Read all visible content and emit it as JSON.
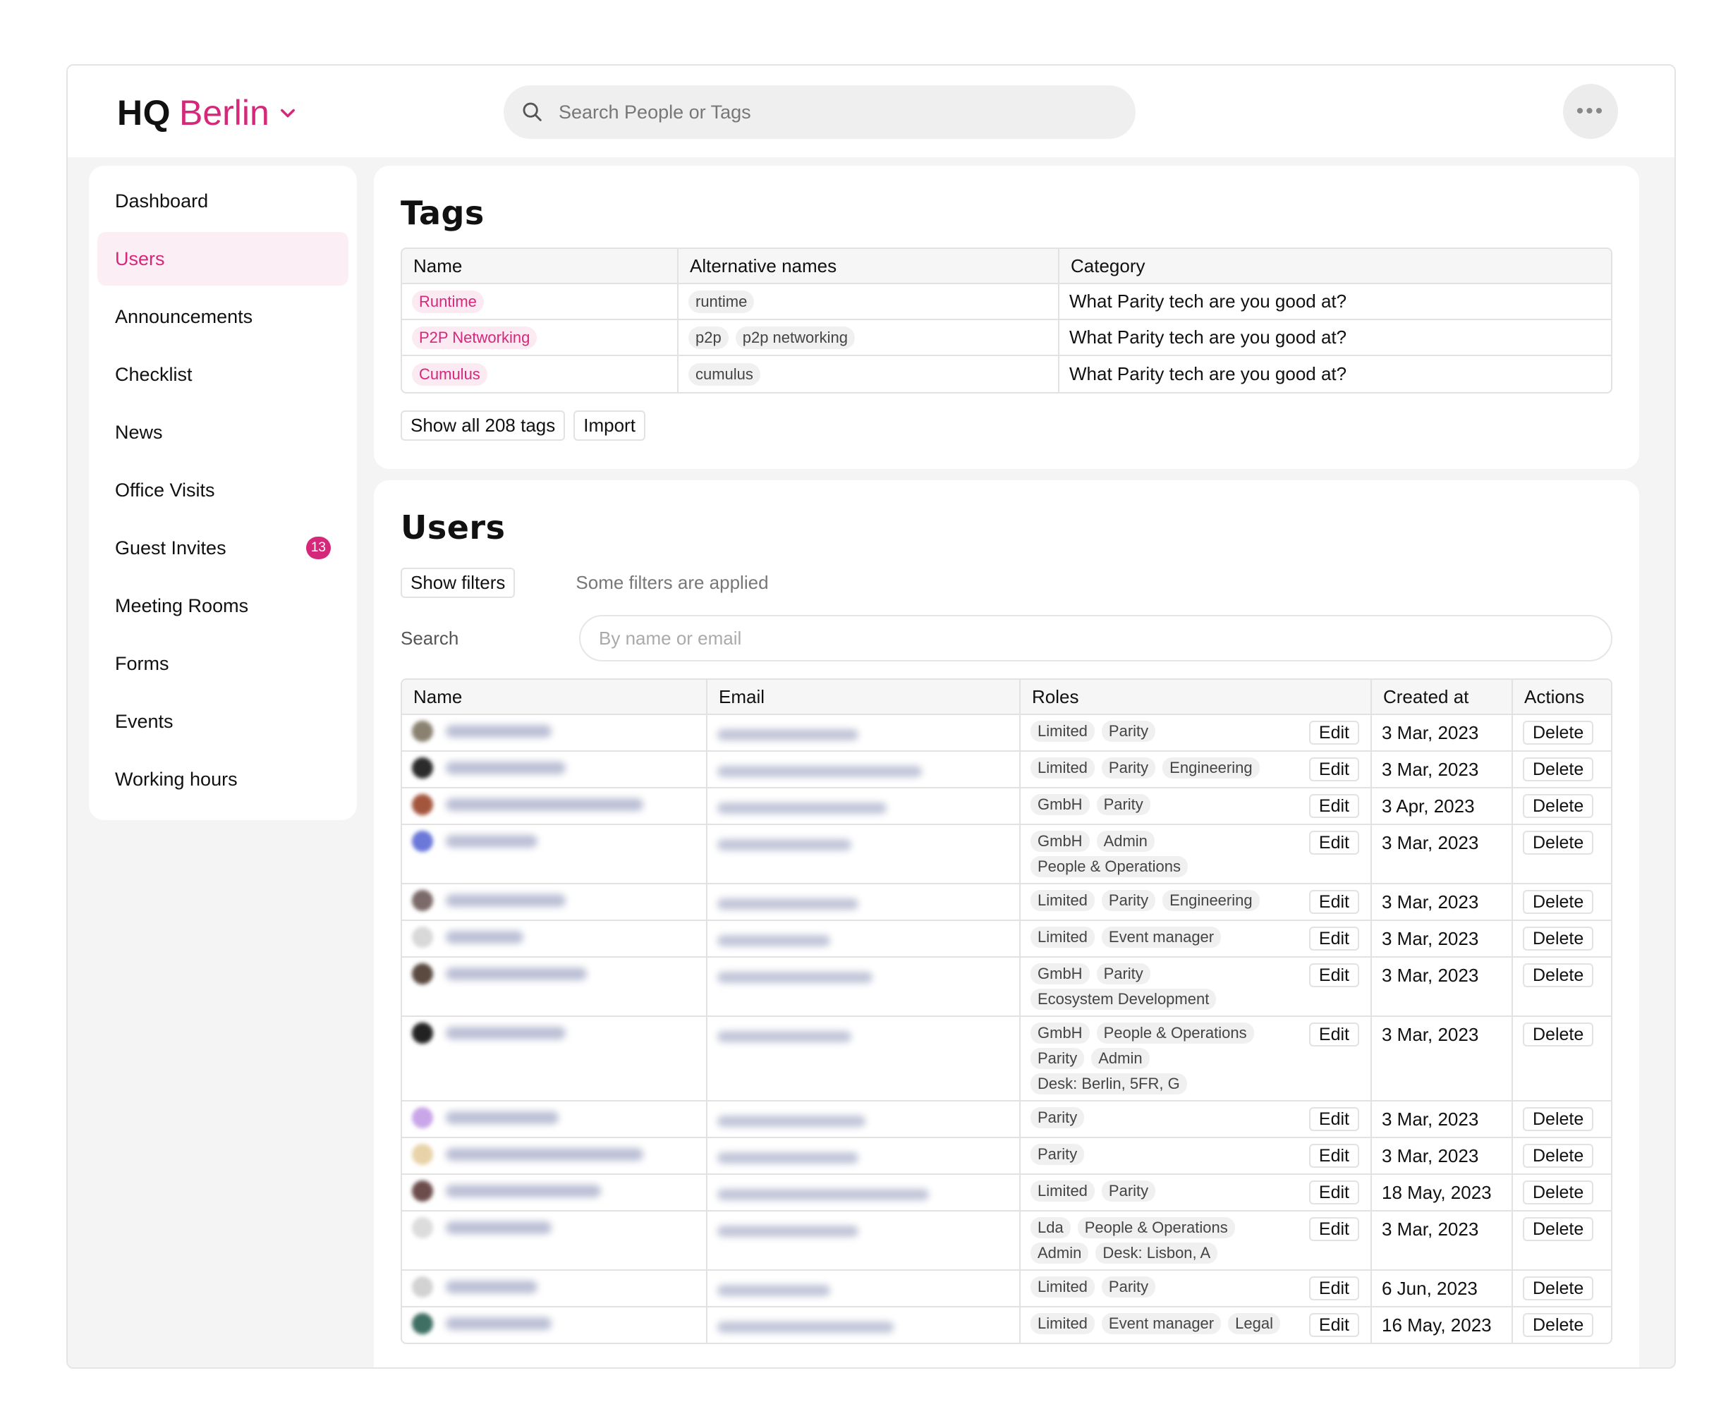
{
  "app": {
    "logo_hq": "HQ",
    "logo_city": "Berlin"
  },
  "search": {
    "placeholder": "Search People or Tags"
  },
  "sidebar": {
    "items": [
      {
        "label": "Dashboard",
        "name": "sidebar-item-dashboard"
      },
      {
        "label": "Users",
        "name": "sidebar-item-users",
        "active": true
      },
      {
        "label": "Announcements",
        "name": "sidebar-item-announcements"
      },
      {
        "label": "Checklist",
        "name": "sidebar-item-checklist"
      },
      {
        "label": "News",
        "name": "sidebar-item-news"
      },
      {
        "label": "Office Visits",
        "name": "sidebar-item-office-visits"
      },
      {
        "label": "Guest Invites",
        "name": "sidebar-item-guest-invites",
        "badge": "13"
      },
      {
        "label": "Meeting Rooms",
        "name": "sidebar-item-meeting-rooms"
      },
      {
        "label": "Forms",
        "name": "sidebar-item-forms"
      },
      {
        "label": "Events",
        "name": "sidebar-item-events"
      },
      {
        "label": "Working hours",
        "name": "sidebar-item-working-hours"
      }
    ]
  },
  "tags": {
    "title": "Tags",
    "headers": [
      "Name",
      "Alternative names",
      "Category"
    ],
    "rows": [
      {
        "name": "Runtime",
        "alts": [
          "runtime"
        ],
        "category": "What Parity tech are you good at?"
      },
      {
        "name": "P2P Networking",
        "alts": [
          "p2p",
          "p2p networking"
        ],
        "category": "What Parity tech are you good at?"
      },
      {
        "name": "Cumulus",
        "alts": [
          "cumulus"
        ],
        "category": "What Parity tech are you good at?"
      }
    ],
    "show_all_label": "Show all 208 tags",
    "import_label": "Import"
  },
  "users": {
    "title": "Users",
    "show_filters_label": "Show filters",
    "filter_note": "Some filters are applied",
    "search_label": "Search",
    "search_placeholder": "By name or email",
    "headers": [
      "Name",
      "Email",
      "Roles",
      "Created at",
      "Actions"
    ],
    "edit_label": "Edit",
    "delete_label": "Delete",
    "rows": [
      {
        "avatar_color": "#8a8170",
        "roles": [
          "Limited",
          "Parity"
        ],
        "created": "3 Mar, 2023"
      },
      {
        "avatar_color": "#2b2b2b",
        "roles": [
          "Limited",
          "Parity",
          "Engineering"
        ],
        "created": "3 Mar, 2023"
      },
      {
        "avatar_color": "#a4563d",
        "roles": [
          "GmbH",
          "Parity"
        ],
        "created": "3 Apr, 2023"
      },
      {
        "avatar_color": "#6b78d8",
        "roles": [
          "GmbH",
          "Admin",
          "People & Operations"
        ],
        "created": "3 Mar, 2023"
      },
      {
        "avatar_color": "#7a6a68",
        "roles": [
          "Limited",
          "Parity",
          "Engineering"
        ],
        "created": "3 Mar, 2023"
      },
      {
        "avatar_color": "#d8d8d8",
        "roles": [
          "Limited",
          "Event manager"
        ],
        "created": "3 Mar, 2023"
      },
      {
        "avatar_color": "#5a4a40",
        "roles": [
          "GmbH",
          "Parity",
          "Ecosystem Development"
        ],
        "created": "3 Mar, 2023"
      },
      {
        "avatar_color": "#222222",
        "roles": [
          "GmbH",
          "People & Operations",
          "Parity",
          "Admin",
          "Desk: Berlin, 5FR, G"
        ],
        "created": "3 Mar, 2023"
      },
      {
        "avatar_color": "#c9a6e8",
        "roles": [
          "Parity"
        ],
        "created": "3 Mar, 2023"
      },
      {
        "avatar_color": "#e8d3a8",
        "roles": [
          "Parity"
        ],
        "created": "3 Mar, 2023"
      },
      {
        "avatar_color": "#6d4c4c",
        "roles": [
          "Limited",
          "Parity"
        ],
        "created": "18 May, 2023"
      },
      {
        "avatar_color": "#dcdcdc",
        "roles": [
          "Lda",
          "People & Operations",
          "Admin",
          "Desk: Lisbon, A"
        ],
        "created": "3 Mar, 2023"
      },
      {
        "avatar_color": "#d2d2d2",
        "roles": [
          "Limited",
          "Parity"
        ],
        "created": "6 Jun, 2023"
      },
      {
        "avatar_color": "#3f6f62",
        "roles": [
          "Limited",
          "Event manager",
          "Legal"
        ],
        "created": "16 May, 2023"
      }
    ]
  }
}
